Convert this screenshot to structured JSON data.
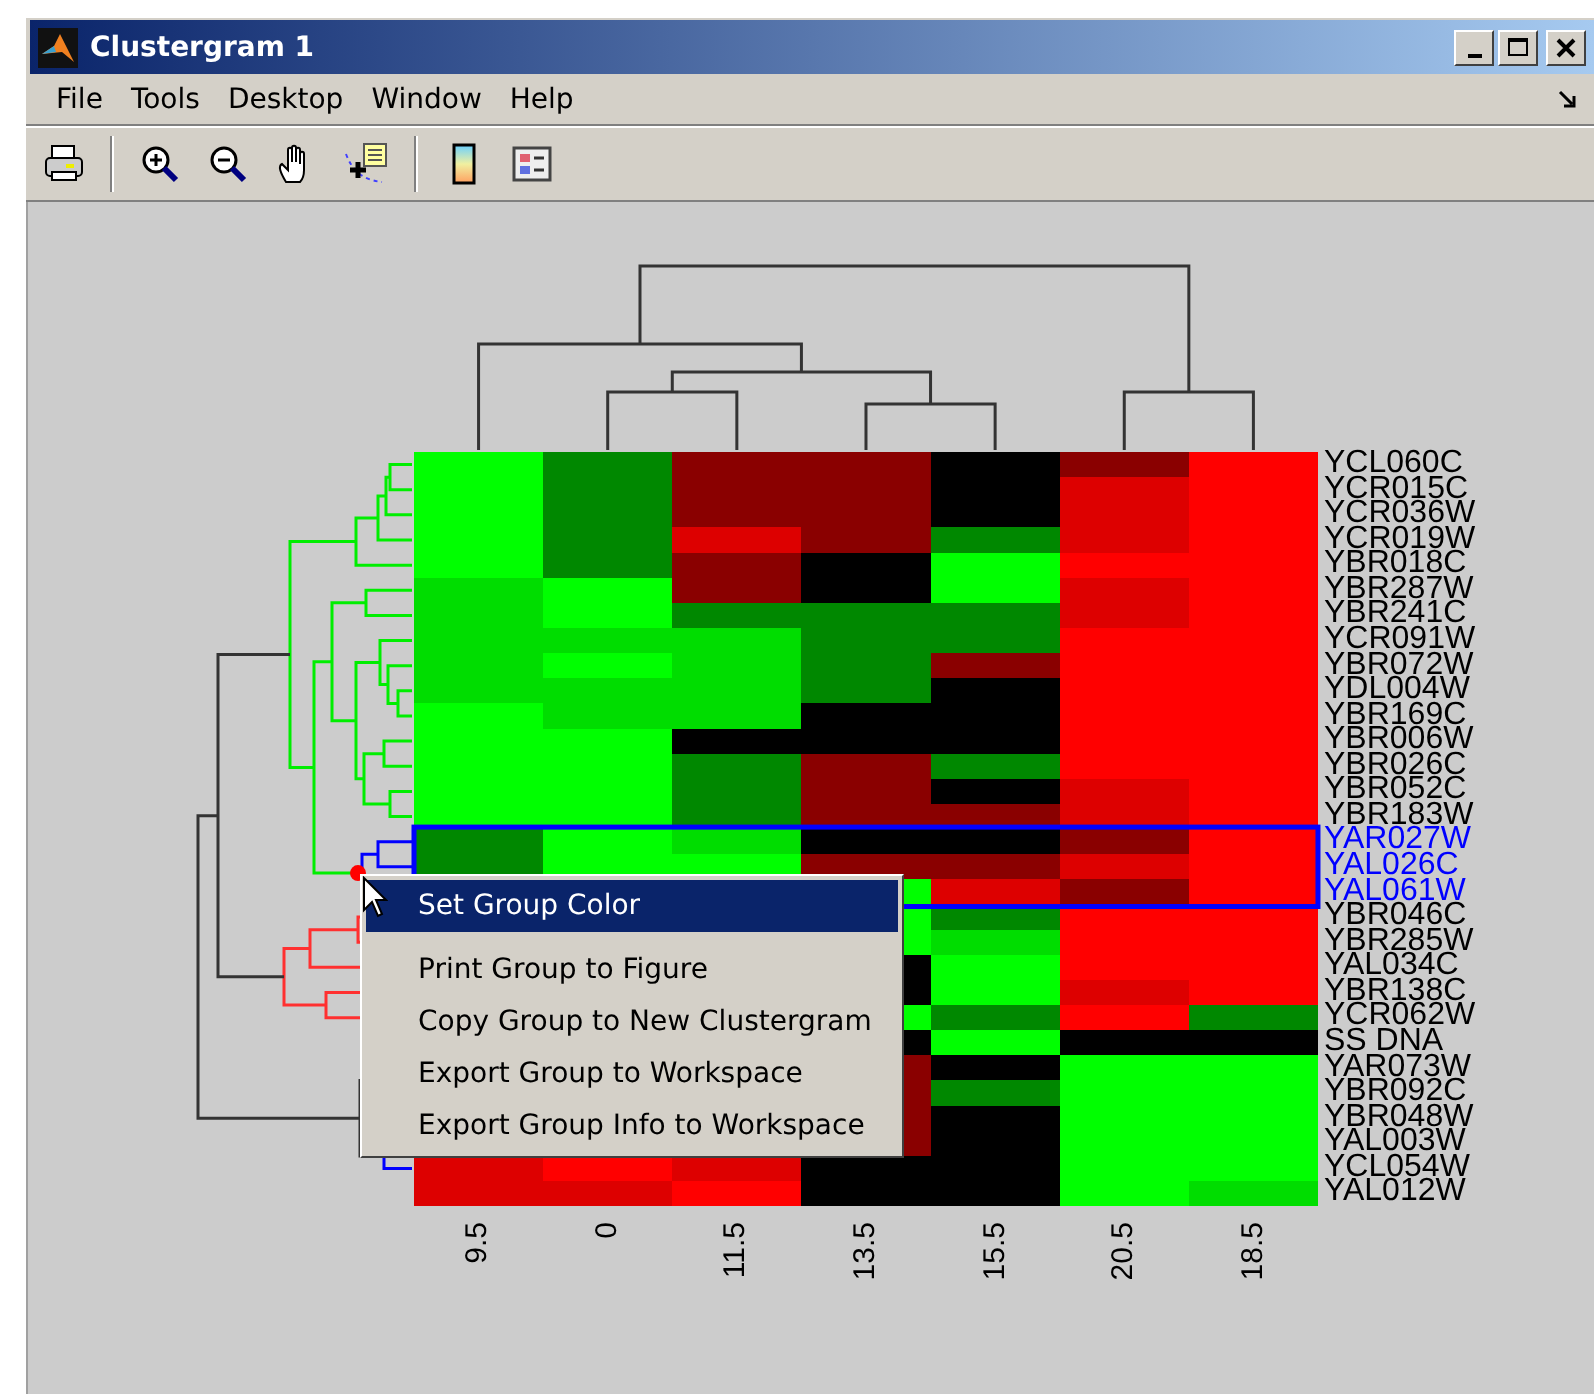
{
  "window": {
    "title": "Clustergram 1"
  },
  "menu": [
    "File",
    "Tools",
    "Desktop",
    "Window",
    "Help"
  ],
  "toolbar": [
    {
      "kind": "print"
    },
    {
      "kind": "separator"
    },
    {
      "kind": "zoom-in"
    },
    {
      "kind": "zoom-out"
    },
    {
      "kind": "pan"
    },
    {
      "kind": "data-cursor"
    },
    {
      "kind": "separator"
    },
    {
      "kind": "colorbar"
    },
    {
      "kind": "legend"
    }
  ],
  "rows": [
    {
      "label": "YCL060C",
      "highlighted": false
    },
    {
      "label": "YCR015C",
      "highlighted": false
    },
    {
      "label": "YCR036W",
      "highlighted": false
    },
    {
      "label": "YCR019W",
      "highlighted": false
    },
    {
      "label": "YBR018C",
      "highlighted": false
    },
    {
      "label": "YBR287W",
      "highlighted": false
    },
    {
      "label": "YBR241C",
      "highlighted": false
    },
    {
      "label": "YCR091W",
      "highlighted": false
    },
    {
      "label": "YBR072W",
      "highlighted": false
    },
    {
      "label": "YDL004W",
      "highlighted": false
    },
    {
      "label": "YBR169C",
      "highlighted": false
    },
    {
      "label": "YBR006W",
      "highlighted": false
    },
    {
      "label": "YBR026C",
      "highlighted": false
    },
    {
      "label": "YBR052C",
      "highlighted": false
    },
    {
      "label": "YBR183W",
      "highlighted": false
    },
    {
      "label": "YAR027W",
      "highlighted": true
    },
    {
      "label": "YAL026C",
      "highlighted": true
    },
    {
      "label": "YAL061W",
      "highlighted": true
    },
    {
      "label": "YBR046C",
      "highlighted": false
    },
    {
      "label": "YBR285W",
      "highlighted": false
    },
    {
      "label": "YAL034C",
      "highlighted": false
    },
    {
      "label": "YBR138C",
      "highlighted": false
    },
    {
      "label": "YCR062W",
      "highlighted": false
    },
    {
      "label": "SS DNA",
      "highlighted": false
    },
    {
      "label": "YAR073W",
      "highlighted": false
    },
    {
      "label": "YBR092C",
      "highlighted": false
    },
    {
      "label": "YBR048W",
      "highlighted": false
    },
    {
      "label": "YAL003W",
      "highlighted": false
    },
    {
      "label": "YCL054W",
      "highlighted": false
    },
    {
      "label": "YAL012W",
      "highlighted": false
    }
  ],
  "columns": [
    "9.5",
    "0",
    "11.5",
    "13.5",
    "15.5",
    "20.5",
    "18.5"
  ],
  "context_menu": {
    "items": [
      {
        "label": "Set Group Color",
        "selected": true
      },
      {
        "label": "Print Group to Figure",
        "selected": false
      },
      {
        "label": "Copy Group to New Clustergram",
        "selected": false
      },
      {
        "label": "Export Group to Workspace",
        "selected": false
      },
      {
        "label": "Export Group Info to Workspace",
        "selected": false
      }
    ]
  }
}
